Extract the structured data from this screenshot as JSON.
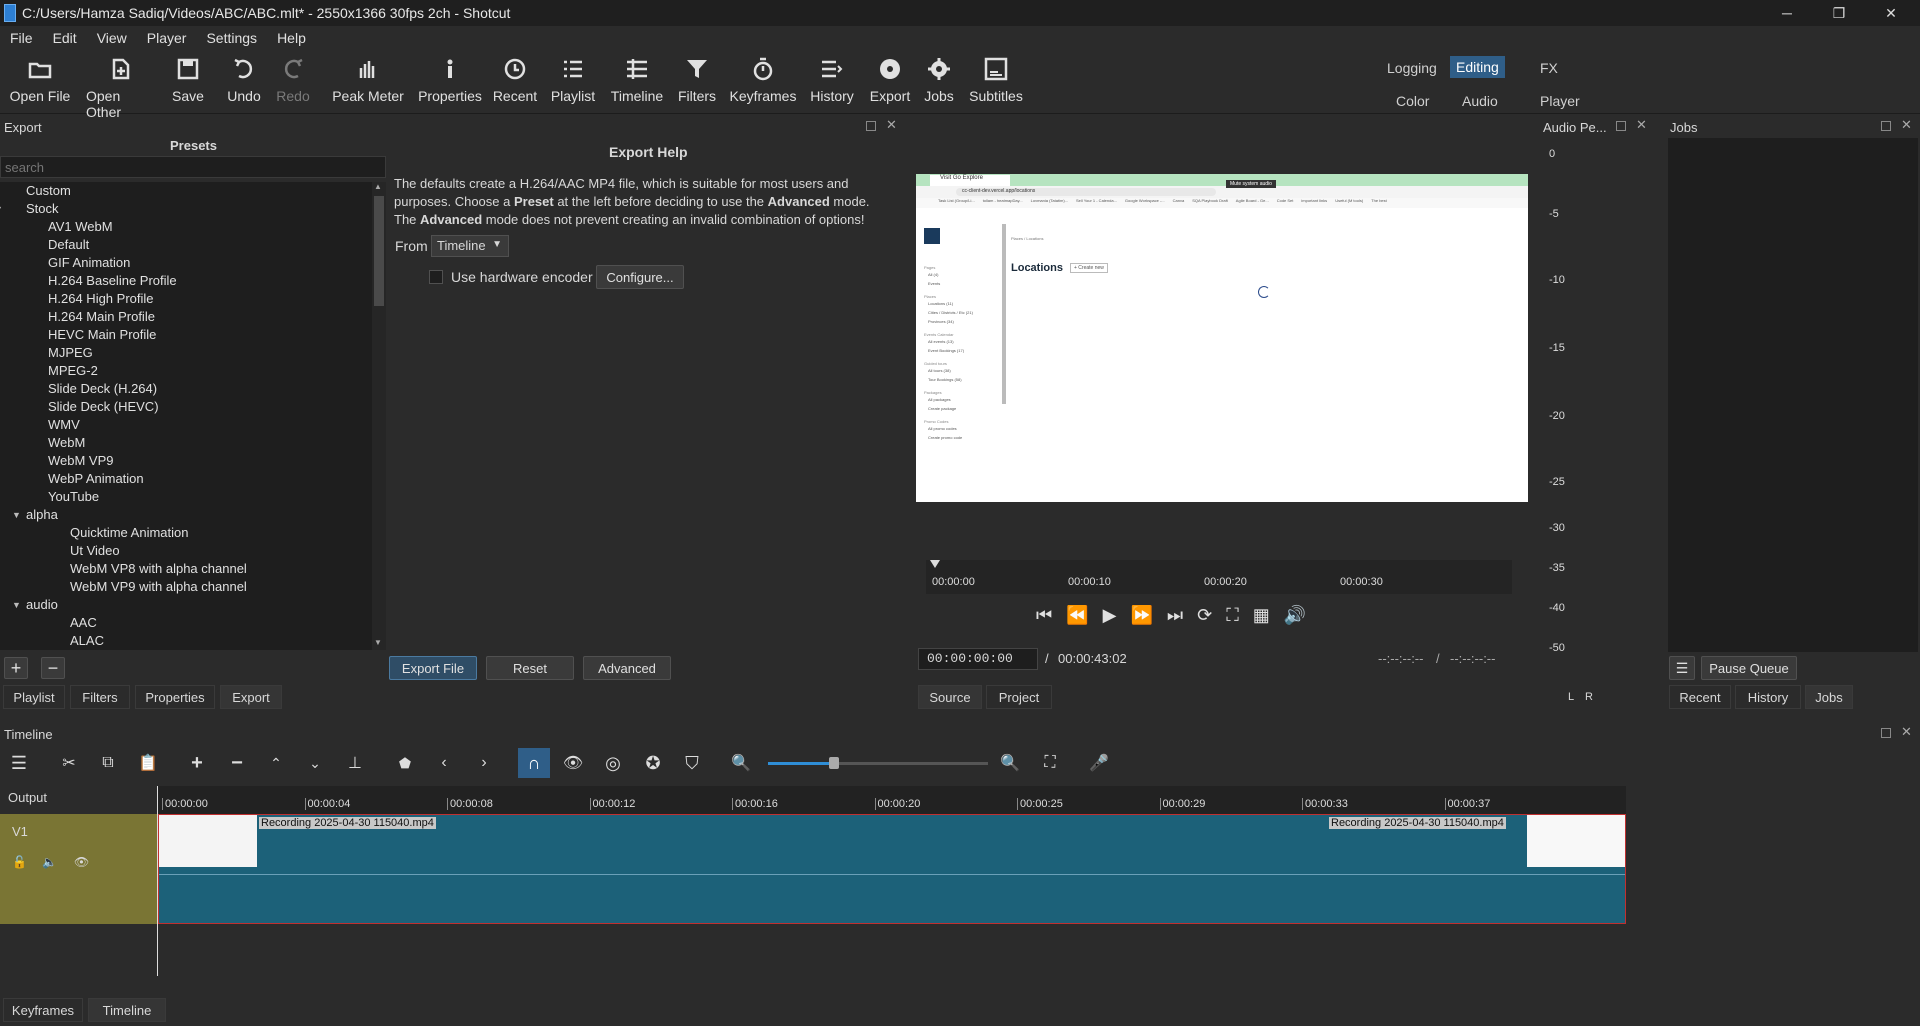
{
  "window": {
    "title": "C:/Users/Hamza Sadiq/Videos/ABC/ABC.mlt* - 2550x1366 30fps 2ch - Shotcut",
    "minimize": "─",
    "maximize": "❐",
    "close": "✕"
  },
  "menu": {
    "file": "File",
    "edit": "Edit",
    "view": "View",
    "player": "Player",
    "settings": "Settings",
    "help": "Help"
  },
  "toolbar": {
    "open_file": "Open File",
    "open_other": "Open Other",
    "save": "Save",
    "undo": "Undo",
    "redo": "Redo",
    "peak_meter": "Peak Meter",
    "properties": "Properties",
    "recent": "Recent",
    "playlist": "Playlist",
    "timeline": "Timeline",
    "filters": "Filters",
    "keyframes": "Keyframes",
    "history": "History",
    "export": "Export",
    "jobs": "Jobs",
    "subtitles": "Subtitles"
  },
  "layouts": {
    "logging": "Logging",
    "editing": "Editing",
    "fx": "FX",
    "color": "Color",
    "audio": "Audio",
    "player": "Player"
  },
  "export_panel": {
    "title": "Export",
    "presets_heading": "Presets",
    "search_placeholder": "search",
    "help_heading": "Export Help",
    "help_line1": "The defaults create a H.264/AAC MP4 file, which is suitable for most users and",
    "help_line2a": "purposes. Choose a ",
    "help_line2b": "Preset",
    "help_line2c": " at the left before deciding to use the ",
    "help_line2d": "Advanced",
    "help_line2e": " mode.",
    "help_line3a": "The ",
    "help_line3b": "Advanced",
    "help_line3c": " mode does not prevent creating an invalid combination of options!",
    "from_label": "From",
    "from_value": "Timeline",
    "hw_encoder_label": "Use hardware encoder",
    "configure_button": "Configure...",
    "export_file_button": "Export File",
    "reset_button": "Reset",
    "advanced_button": "Advanced",
    "add_icon": "+",
    "remove_icon": "−"
  },
  "presets": [
    {
      "label": "Custom",
      "level": 1
    },
    {
      "label": "Stock",
      "level": 0,
      "expanded": true
    },
    {
      "label": "AV1 WebM",
      "level": 2
    },
    {
      "label": "Default",
      "level": 2
    },
    {
      "label": "GIF Animation",
      "level": 2
    },
    {
      "label": "H.264 Baseline Profile",
      "level": 2
    },
    {
      "label": "H.264 High Profile",
      "level": 2
    },
    {
      "label": "H.264 Main Profile",
      "level": 2
    },
    {
      "label": "HEVC Main Profile",
      "level": 2
    },
    {
      "label": "MJPEG",
      "level": 2
    },
    {
      "label": "MPEG-2",
      "level": 2
    },
    {
      "label": "Slide Deck (H.264)",
      "level": 2
    },
    {
      "label": "Slide Deck (HEVC)",
      "level": 2
    },
    {
      "label": "WMV",
      "level": 2
    },
    {
      "label": "WebM",
      "level": 2
    },
    {
      "label": "WebM VP9",
      "level": 2
    },
    {
      "label": "WebP Animation",
      "level": 2
    },
    {
      "label": "YouTube",
      "level": 2
    },
    {
      "label": "alpha",
      "level": 1,
      "expanded": true
    },
    {
      "label": "Quicktime Animation",
      "level": 3
    },
    {
      "label": "Ut Video",
      "level": 3
    },
    {
      "label": "WebM VP8 with alpha channel",
      "level": 3
    },
    {
      "label": "WebM VP9 with alpha channel",
      "level": 3
    },
    {
      "label": "audio",
      "level": 1,
      "expanded": true
    },
    {
      "label": "AAC",
      "level": 3
    },
    {
      "label": "ALAC",
      "level": 3
    }
  ],
  "left_tabs": {
    "playlist": "Playlist",
    "filters": "Filters",
    "properties": "Properties",
    "export": "Export"
  },
  "player": {
    "ruler": [
      "00:00:00",
      "00:00:10",
      "00:00:20",
      "00:00:30"
    ],
    "timecode": "00:00:00:00",
    "separator": "/",
    "duration": "00:00:43:02",
    "in_point": "--:--:--:--",
    "out_point": "--:--:--:--",
    "source_tab": "Source",
    "project_tab": "Project"
  },
  "preview_page": {
    "tab_title": "Visit Go Explore",
    "url": "cc-client-dev.vercel.app/locations",
    "tooltip": "Mute system audio",
    "heading": "Locations",
    "create_button": "+ Create new",
    "breadcrumb_1": "Places",
    "breadcrumb_2": "Locations",
    "bookmarks": [
      "Task List (Group/Li...",
      "tollam - heatmapDay...",
      "Lovmania (Tatatim)...",
      "Sell Your 1 - Calenda...",
      "Google Workspace -...",
      "Canva",
      "SQA Playbook Draft",
      "Agile Board - Ge...",
      "Code Set",
      "important links",
      "Useful (M tools)",
      "The best"
    ],
    "sidebar": [
      {
        "group": "Pages",
        "items": [
          "All (4)",
          "Events"
        ]
      },
      {
        "group": "Places",
        "items": [
          "Locations (11)",
          "Cities / Districts / Etc (21)",
          "Provinces (34)"
        ]
      },
      {
        "group": "Events Calendar",
        "items": [
          "All events (13)",
          "Event Bookings (17)"
        ]
      },
      {
        "group": "Guided tours",
        "items": [
          "All tours (38)",
          "Tour Bookings (58)"
        ]
      },
      {
        "group": "Packages",
        "items": [
          "All packages",
          "Create package"
        ]
      },
      {
        "group": "Promo Codes",
        "items": [
          "All promo codes",
          "Create promo code"
        ]
      }
    ]
  },
  "audio_meter": {
    "title": "Audio Pe...",
    "labels": [
      "0",
      "-5",
      "-10",
      "-15",
      "-20",
      "-25",
      "-30",
      "-35",
      "-40",
      "-50"
    ],
    "left": "L",
    "right": "R"
  },
  "jobs_panel": {
    "title": "Jobs",
    "pause_queue": "Pause Queue",
    "recent_tab": "Recent",
    "history_tab": "History",
    "jobs_tab": "Jobs"
  },
  "timeline": {
    "title": "Timeline",
    "output_label": "Output",
    "track_name": "V1",
    "ruler": [
      "00:00:00",
      "00:00:04",
      "00:00:08",
      "00:00:12",
      "00:00:16",
      "00:00:20",
      "00:00:25",
      "00:00:29",
      "00:00:33",
      "00:00:37"
    ],
    "clip_name_start": "Recording 2025-04-30 115040.mp4",
    "clip_name_end": "Recording 2025-04-30 115040.mp4",
    "zoom_level": 0.3
  },
  "bottom_tabs": {
    "keyframes": "Keyframes",
    "timeline": "Timeline"
  }
}
